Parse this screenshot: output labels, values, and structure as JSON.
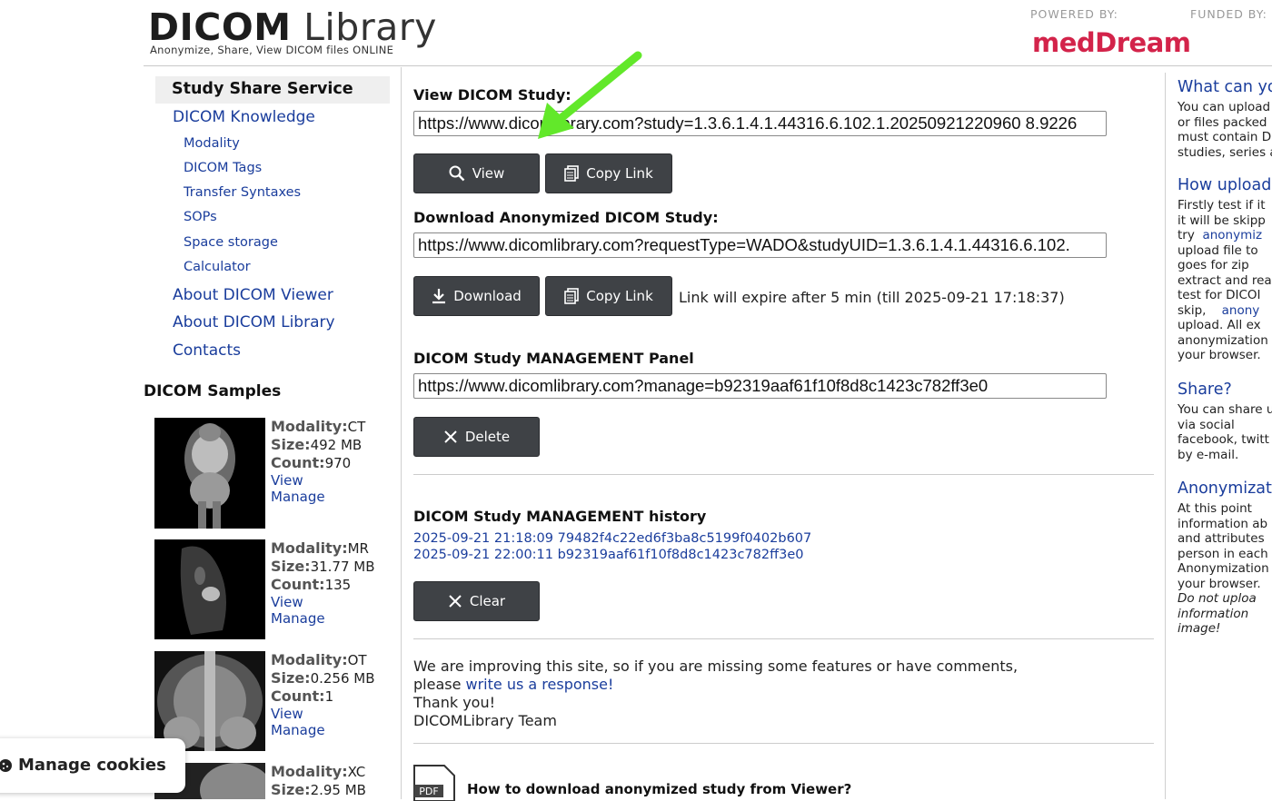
{
  "header": {
    "logo_bold": "DICOM",
    "logo_light": "Library",
    "logo_sub": "Anonymize, Share, View DICOM files ONLINE",
    "powered_by": "POWERED BY:",
    "funded_by": "FUNDED BY:",
    "sponsor": "medDream"
  },
  "nav": {
    "active": "Study Share Service",
    "items": [
      {
        "label": "DICOM Knowledge"
      },
      {
        "label": "Modality"
      },
      {
        "label": "DICOM Tags"
      },
      {
        "label": "Transfer Syntaxes"
      },
      {
        "label": "SOPs"
      },
      {
        "label": "Space storage"
      },
      {
        "label": "Calculator"
      },
      {
        "label": "About DICOM Viewer"
      },
      {
        "label": "About DICOM Library"
      },
      {
        "label": "Contacts"
      }
    ]
  },
  "samples": {
    "title": "DICOM Samples",
    "k_modality": "Modality:",
    "k_size": "Size:",
    "k_count": "Count:",
    "view": "View",
    "manage": "Manage",
    "items": [
      {
        "modality": "CT",
        "size": "492 MB",
        "count": "970"
      },
      {
        "modality": "MR",
        "size": "31.77 MB",
        "count": "135"
      },
      {
        "modality": "OT",
        "size": "0.256 MB",
        "count": "1"
      },
      {
        "modality": "XC",
        "size": "2.95 MB",
        "count": ""
      }
    ]
  },
  "view_study": {
    "title": "View DICOM Study:",
    "url": "https://www.dicomlibrary.com?study=1.3.6.1.4.1.44316.6.102.1.20250921220960 8.9226",
    "view_btn": "View",
    "copy_btn": "Copy Link"
  },
  "download_study": {
    "title": "Download Anonymized DICOM Study:",
    "url": "https://www.dicomlibrary.com?requestType=WADO&studyUID=1.3.6.1.4.1.44316.6.102.",
    "download_btn": "Download",
    "copy_btn": "Copy Link",
    "expire_note": "Link will expire after 5 min (till 2025-09-21 17:18:37)"
  },
  "management": {
    "title": "DICOM Study MANAGEMENT Panel",
    "url": "https://www.dicomlibrary.com?manage=b92319aaf61f10f8d8c1423c782ff3e0",
    "delete_btn": "Delete"
  },
  "history": {
    "title": "DICOM Study MANAGEMENT history",
    "entries": [
      "2025-09-21 21:18:09 79482f4c22ed6f3ba8c5199f0402b607",
      "2025-09-21 22:00:11 b92319aaf61f10f8d8c1423c782ff3e0"
    ],
    "clear_btn": "Clear"
  },
  "feedback": {
    "line1": "We are improving this site, so if you are missing some features or have comments,",
    "line2_prefix": "please ",
    "link": "write us a response!",
    "line3": "Thank you!",
    "line4": "DICOMLibrary Team"
  },
  "pdf": {
    "icon_label": "PDF",
    "title": "How to download anonymized study from Viewer?"
  },
  "right": {
    "h1": "What can yo",
    "p1": [
      "You can upload",
      "or files packed",
      "must contain D",
      "studies, series a"
    ],
    "h2": "How upload",
    "p2": [
      "Firstly test if it",
      "it will be skipp",
      "upload file to",
      "goes for zip",
      "extract and rea",
      "test for DICOI",
      "upload. All ex",
      "anonymization",
      "your browser."
    ],
    "p2_try": "try",
    "p2_try_link": "anonymiz",
    "p2_skip": "skip,",
    "p2_skip_link": "anony",
    "h3": "Share?",
    "p3": [
      "You can share u",
      "via social",
      "facebook, twitt",
      "by e-mail."
    ],
    "h4": "Anonymizati",
    "p4": [
      "At this point",
      "information ab",
      "and attributes",
      "person in each",
      "Anonymization",
      "your browser."
    ],
    "p4_italic": [
      "Do not uploa",
      "information",
      "image!"
    ]
  },
  "cookies": {
    "label": "Manage cookies"
  },
  "colors": {
    "link": "#1a3d9c",
    "button_bg": "#3f4246",
    "brand": "#d3234a",
    "arrow": "#62e82a"
  }
}
